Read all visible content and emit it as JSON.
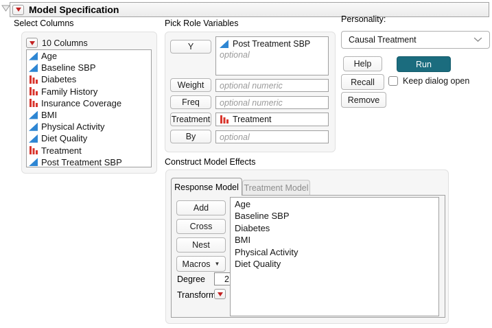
{
  "title": "Model Specification",
  "select_columns": {
    "label": "Select Columns",
    "count_label": "10 Columns",
    "columns": [
      {
        "name": "Age",
        "type": "continuous"
      },
      {
        "name": "Baseline SBP",
        "type": "continuous"
      },
      {
        "name": "Diabetes",
        "type": "nominal"
      },
      {
        "name": "Family History",
        "type": "nominal"
      },
      {
        "name": "Insurance Coverage",
        "type": "nominal"
      },
      {
        "name": "BMI",
        "type": "continuous"
      },
      {
        "name": "Physical Activity",
        "type": "continuous"
      },
      {
        "name": "Diet Quality",
        "type": "continuous"
      },
      {
        "name": "Treatment",
        "type": "nominal"
      },
      {
        "name": "Post Treatment SBP",
        "type": "continuous"
      }
    ]
  },
  "pick_roles": {
    "label": "Pick Role Variables",
    "y": {
      "button_label": "Y",
      "value": "Post Treatment SBP",
      "value_type": "continuous",
      "placeholder": "optional"
    },
    "weight": {
      "button_label": "Weight",
      "placeholder": "optional numeric"
    },
    "freq": {
      "button_label": "Freq",
      "placeholder": "optional numeric"
    },
    "treatment": {
      "button_label": "Treatment",
      "value": "Treatment",
      "value_type": "nominal"
    },
    "by": {
      "button_label": "By",
      "placeholder": "optional"
    }
  },
  "personality": {
    "label": "Personality:",
    "selected_option": "Causal Treatment",
    "help_label": "Help",
    "run_label": "Run",
    "recall_label": "Recall",
    "remove_label": "Remove",
    "keep_dialog_label": "Keep dialog open",
    "keep_dialog_checked": false
  },
  "model_effects": {
    "label": "Construct Model Effects",
    "tabs": [
      "Response Model",
      "Treatment Model"
    ],
    "active_tab": "Response Model",
    "add_label": "Add",
    "cross_label": "Cross",
    "nest_label": "Nest",
    "macros_label": "Macros",
    "degree_label": "Degree",
    "degree_value": "2",
    "transform_label": "Transform",
    "effects": [
      "Age",
      "Baseline SBP",
      "Diabetes",
      "BMI",
      "Physical Activity",
      "Diet Quality"
    ]
  },
  "colors": {
    "run_button": "#1b6c7e",
    "continuous_icon": "#2e86d3",
    "nominal_icon": "#d9352c",
    "red_triangle": "#c22222"
  }
}
